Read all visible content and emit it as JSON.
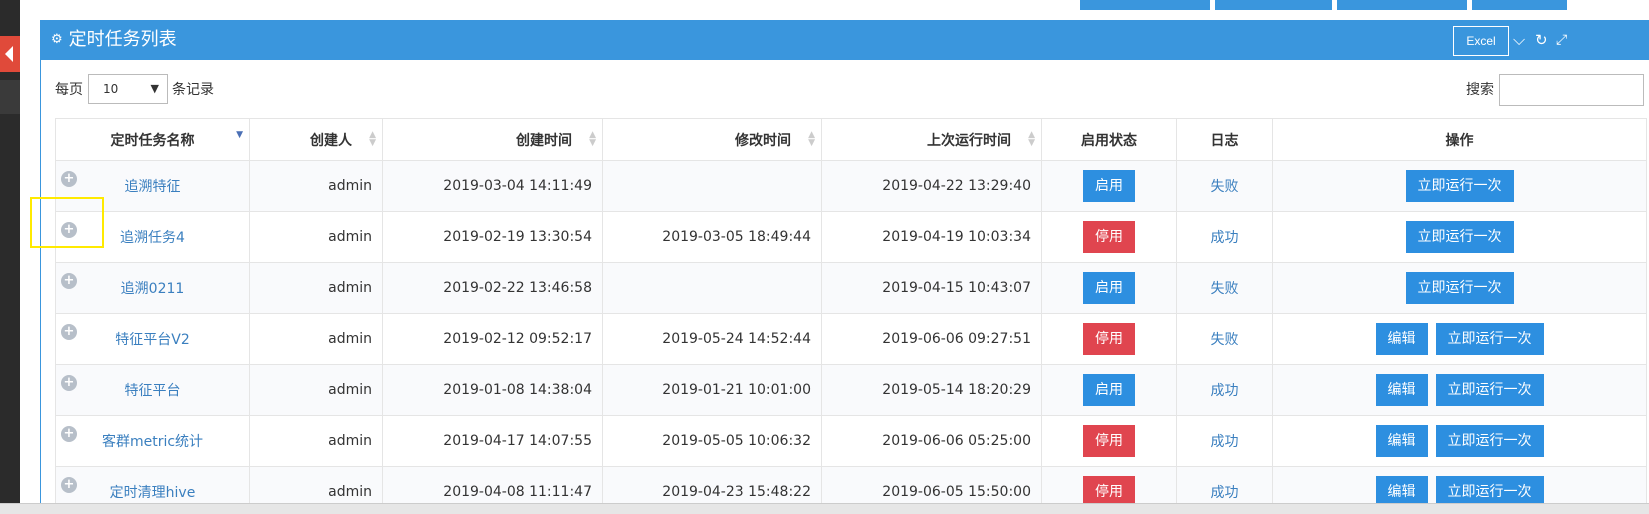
{
  "panel": {
    "title": "定时任务列表",
    "excel_label": "Excel"
  },
  "icons": {
    "gear": "gear-icon",
    "collapse": "chevron-down-icon",
    "refresh": "refresh-icon",
    "expand": "expand-icon",
    "plus": "plus-circle-icon"
  },
  "colors": {
    "primary": "#3a96dd",
    "enable": "#2d8fe0",
    "disable": "#e0454f",
    "link": "#3a7fbf",
    "highlight": "#ffea00"
  },
  "controls": {
    "per_page_label": "每页",
    "per_page_value": "10",
    "records_label": "条记录",
    "search_label": "搜索",
    "search_value": ""
  },
  "table": {
    "headers": {
      "name": "定时任务名称",
      "creator": "创建人",
      "created": "创建时间",
      "modified": "修改时间",
      "last_run": "上次运行时间",
      "status": "启用状态",
      "log": "日志",
      "action": "操作"
    },
    "rows": [
      {
        "name": "追溯特征",
        "creator": "admin",
        "created": "2019-03-04 14:11:49",
        "modified": "",
        "last_run": "2019-04-22 13:29:40",
        "status": "启用",
        "status_type": "on",
        "log": "失败",
        "edit": "",
        "run": "立即运行一次"
      },
      {
        "name": "追溯任务4",
        "creator": "admin",
        "created": "2019-02-19 13:30:54",
        "modified": "2019-03-05 18:49:44",
        "last_run": "2019-04-19 10:03:34",
        "status": "停用",
        "status_type": "off",
        "log": "成功",
        "edit": "",
        "run": "立即运行一次"
      },
      {
        "name": "追溯0211",
        "creator": "admin",
        "created": "2019-02-22 13:46:58",
        "modified": "",
        "last_run": "2019-04-15 10:43:07",
        "status": "启用",
        "status_type": "on",
        "log": "失败",
        "edit": "",
        "run": "立即运行一次"
      },
      {
        "name": "特征平台V2",
        "creator": "admin",
        "created": "2019-02-12 09:52:17",
        "modified": "2019-05-24 14:52:44",
        "last_run": "2019-06-06 09:27:51",
        "status": "停用",
        "status_type": "off",
        "log": "失败",
        "edit": "编辑",
        "run": "立即运行一次"
      },
      {
        "name": "特征平台",
        "creator": "admin",
        "created": "2019-01-08 14:38:04",
        "modified": "2019-01-21 10:01:00",
        "last_run": "2019-05-14 18:20:29",
        "status": "启用",
        "status_type": "on",
        "log": "成功",
        "edit": "编辑",
        "run": "立即运行一次"
      },
      {
        "name": "客群metric统计",
        "creator": "admin",
        "created": "2019-04-17 14:07:55",
        "modified": "2019-05-05 10:06:32",
        "last_run": "2019-06-06 05:25:00",
        "status": "停用",
        "status_type": "off",
        "log": "成功",
        "edit": "编辑",
        "run": "立即运行一次"
      },
      {
        "name": "定时清理hive",
        "creator": "admin",
        "created": "2019-04-08 11:11:47",
        "modified": "2019-04-23 15:48:22",
        "last_run": "2019-06-05 15:50:00",
        "status": "停用",
        "status_type": "off",
        "log": "成功",
        "edit": "编辑",
        "run": "立即运行一次"
      }
    ]
  }
}
